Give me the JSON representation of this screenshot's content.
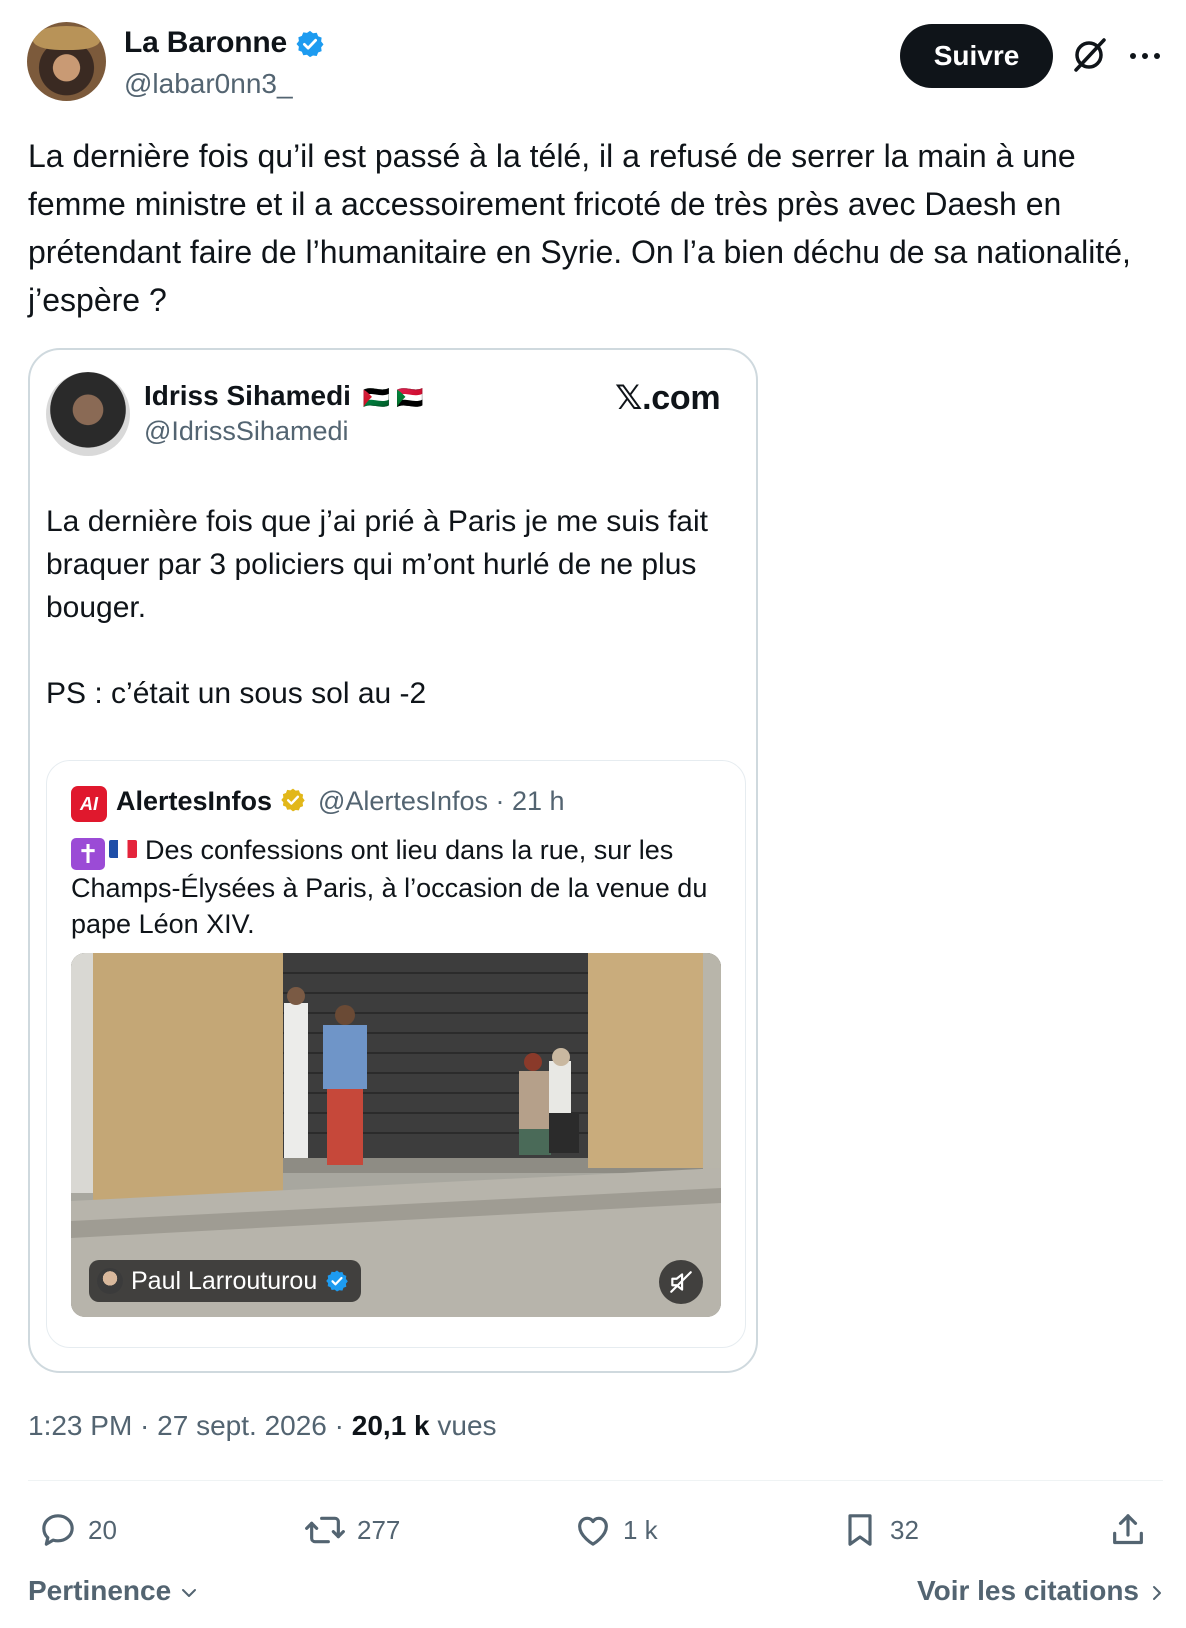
{
  "author": {
    "name": "La Baronne",
    "handle": "@labar0nn3_"
  },
  "header": {
    "follow_label": "Suivre"
  },
  "tweet": {
    "text": "La dernière fois qu’il est passé à la télé, il a refusé de serrer la main à une femme ministre et il a accessoirement fricoté de très près avec Daesh en prétendant faire de l’humanitaire en Syrie. On l’a bien déchu de sa nationalité, j’espère ?"
  },
  "quoted_tweet": {
    "name": "Idriss Sihamedi",
    "flags": "🇵🇸 🇸🇩",
    "handle": "@IdrissSihamedi",
    "source_label": "𝕏.com",
    "text": "La dernière fois que j’ai prié à Paris je me suis fait braquer par 3 policiers qui m’ont hurlé de ne plus bouger.\n\nPS : c’était un sous sol au -2",
    "nested": {
      "logo_text": "AI",
      "name": "AlertesInfos",
      "meta": "@AlertesInfos · 21 h",
      "cross_emoji": "✝",
      "text": "Des confessions ont lieu dans la rue, sur les Champs-Élysées à Paris, à l’occasion de la venue du pape Léon XIV.",
      "video_tag_name": "Paul Larrouturou"
    }
  },
  "meta": {
    "time": "1:23 PM",
    "date": "27 sept. 2026",
    "views_count": "20,1 k",
    "views_label": "vues"
  },
  "actions": {
    "replies": "20",
    "reposts": "277",
    "likes": "1 k",
    "bookmarks": "32"
  },
  "footer": {
    "sort_label": "Pertinence",
    "quotes_label": "Voir les citations"
  },
  "colors": {
    "verified_blue": "#1d9bf0",
    "verified_gold": "#e2b719",
    "text_primary": "#0f1419",
    "text_secondary": "#536471",
    "border": "#cfd9de"
  }
}
